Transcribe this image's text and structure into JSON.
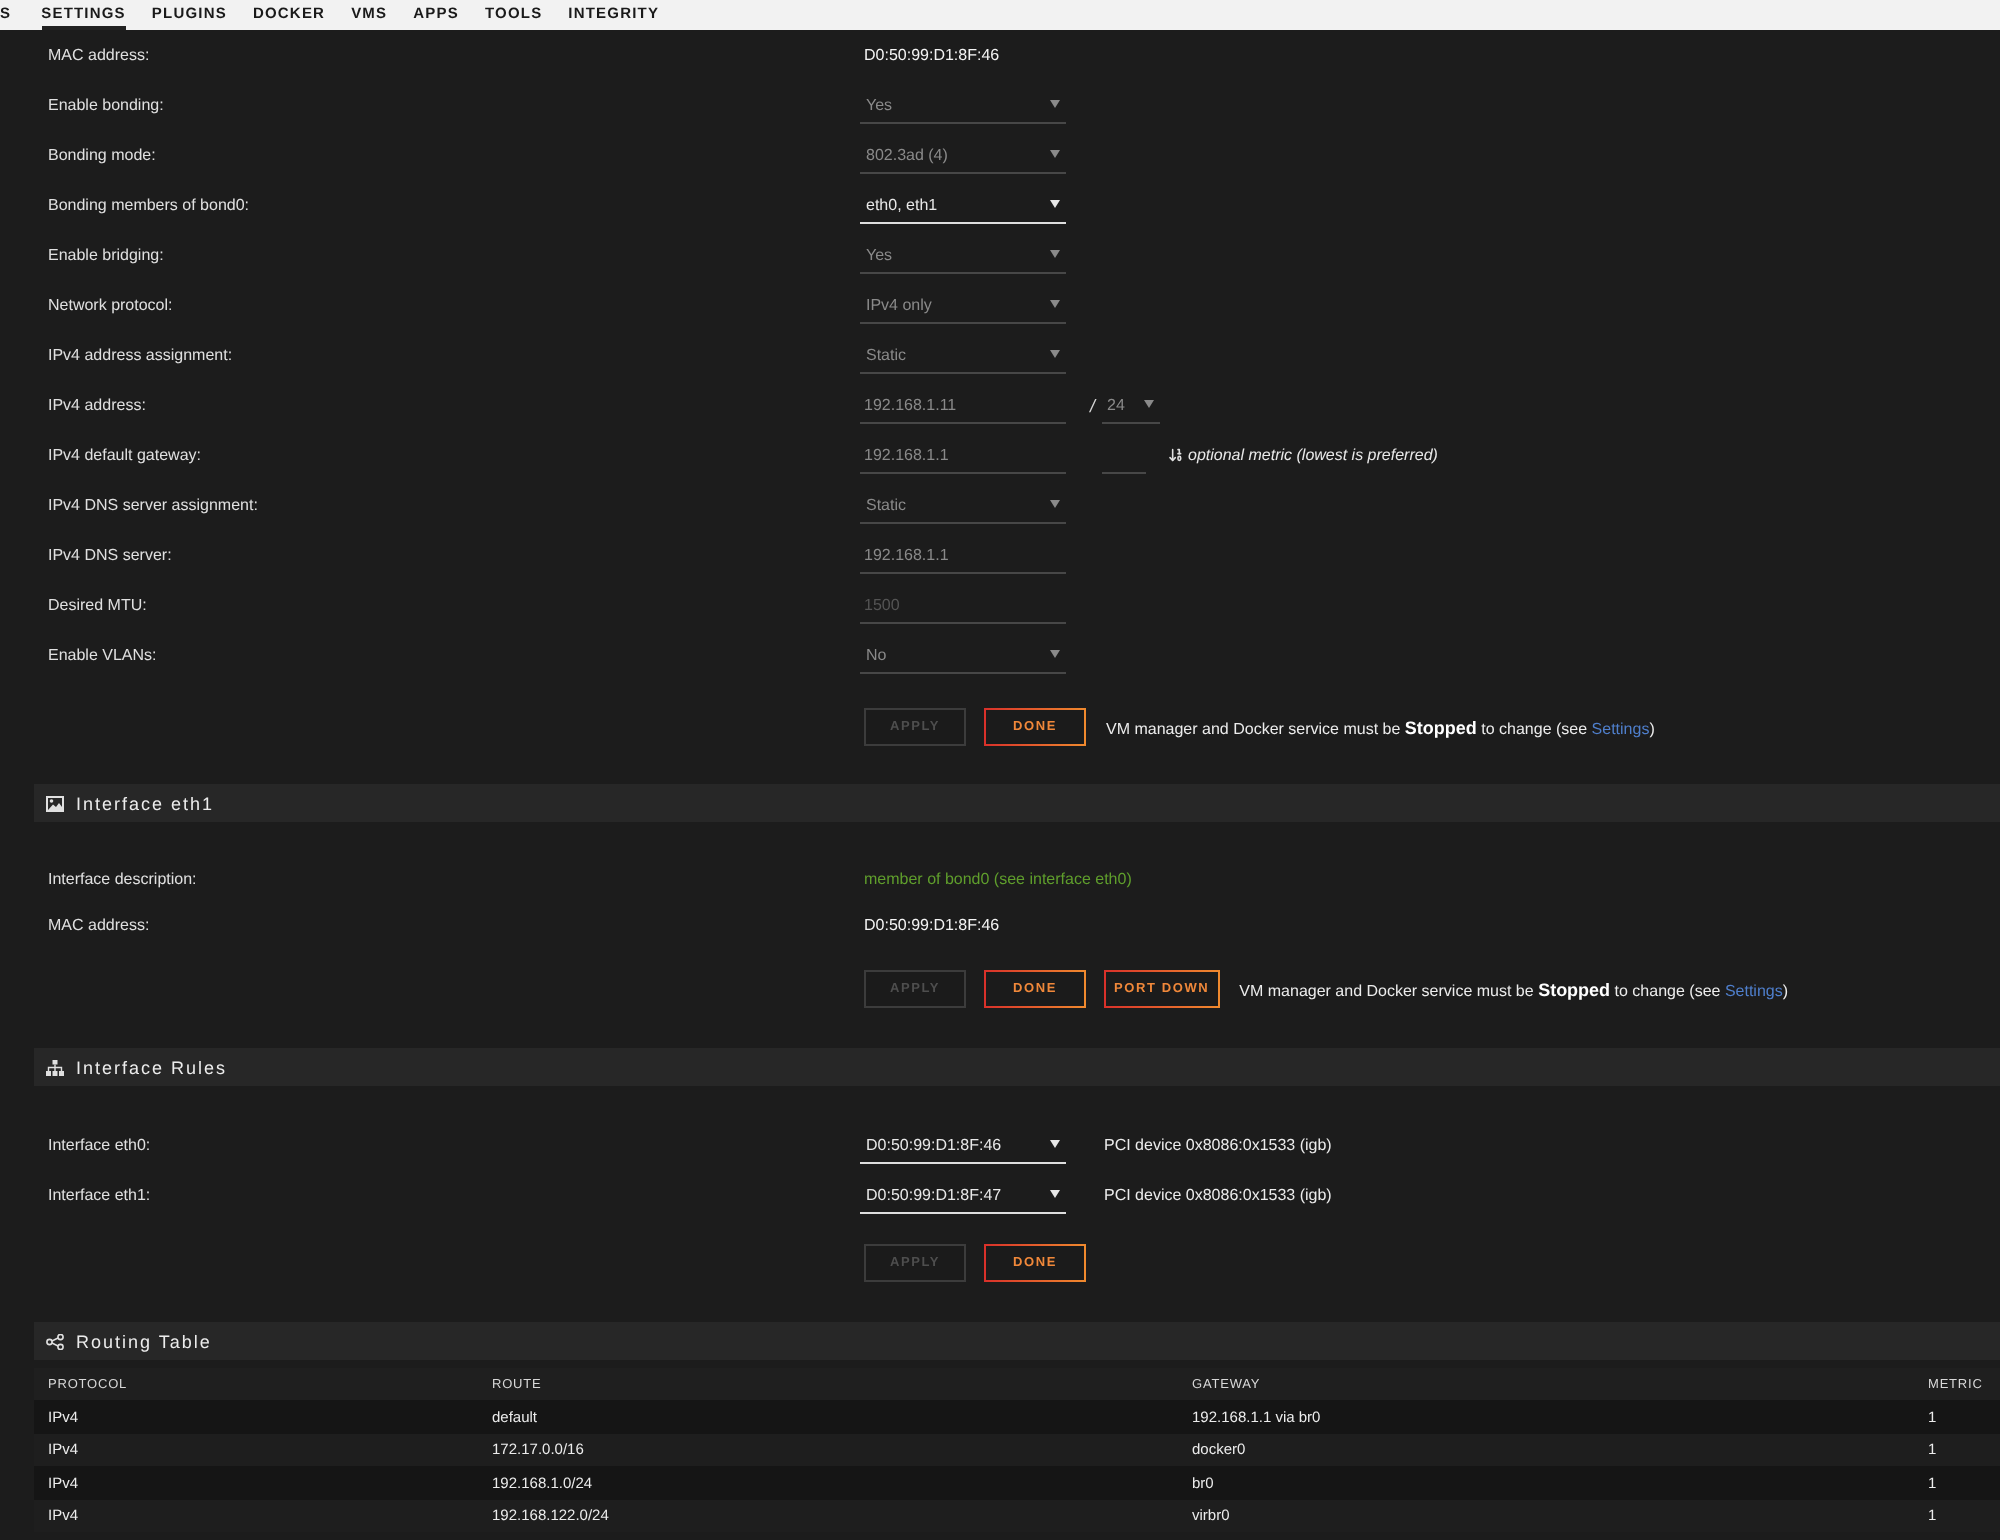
{
  "top_nav": {
    "tabs": [
      {
        "label": "S",
        "selected": false
      },
      {
        "label": "SETTINGS",
        "selected": true
      },
      {
        "label": "PLUGINS",
        "selected": false
      },
      {
        "label": "DOCKER",
        "selected": false
      },
      {
        "label": "VMS",
        "selected": false
      },
      {
        "label": "APPS",
        "selected": false
      },
      {
        "label": "TOOLS",
        "selected": false
      },
      {
        "label": "INTEGRITY",
        "selected": false
      }
    ]
  },
  "interface_eth0": {
    "rows": [
      {
        "label": "MAC address:",
        "kind": "text",
        "value": "D0:50:99:D1:8F:46"
      },
      {
        "label": "Enable bonding:",
        "kind": "select",
        "value": "Yes",
        "disabled": true
      },
      {
        "label": "Bonding mode:",
        "kind": "select",
        "value": "802.3ad (4)",
        "disabled": true
      },
      {
        "label": "Bonding members of bond0:",
        "kind": "select",
        "value": "eth0, eth1",
        "disabled": false
      },
      {
        "label": "Enable bridging:",
        "kind": "select",
        "value": "Yes",
        "disabled": true
      },
      {
        "label": "Network protocol:",
        "kind": "select",
        "value": "IPv4 only",
        "disabled": true
      },
      {
        "label": "IPv4 address assignment:",
        "kind": "select",
        "value": "Static",
        "disabled": true
      },
      {
        "label": "IPv4 address:",
        "kind": "address",
        "value": "192.168.1.11",
        "disabled": true,
        "separator": "/",
        "prefix": "24"
      },
      {
        "label": "IPv4 default gateway:",
        "kind": "gateway",
        "value": "192.168.1.1",
        "disabled": true,
        "metric_hint": "optional metric (lowest is preferred)"
      },
      {
        "label": "IPv4 DNS server assignment:",
        "kind": "select",
        "value": "Static",
        "disabled": true
      },
      {
        "label": "IPv4 DNS server:",
        "kind": "input",
        "value": "192.168.1.1",
        "disabled": true
      },
      {
        "label": "Desired MTU:",
        "kind": "input",
        "placeholder": "1500",
        "disabled": true
      },
      {
        "label": "Enable VLANs:",
        "kind": "select",
        "value": "No",
        "disabled": true
      }
    ],
    "buttons": [
      {
        "label": "APPLY",
        "disabled": true
      },
      {
        "label": "DONE",
        "disabled": false
      }
    ],
    "notice": {
      "text": "VM manager and Docker service must be **Stopped** to change (see ",
      "link": "Settings",
      "after": ")"
    }
  },
  "interface_eth1": {
    "title": "Interface eth1",
    "rows": [
      {
        "label": "Interface description:",
        "kind": "status",
        "value": "member of bond0 (see interface eth0)"
      },
      {
        "label": "MAC address:",
        "kind": "text",
        "value": "D0:50:99:D1:8F:46"
      }
    ],
    "buttons": [
      {
        "label": "APPLY",
        "disabled": true
      },
      {
        "label": "DONE",
        "disabled": false
      },
      {
        "label": "PORT DOWN",
        "disabled": false
      }
    ],
    "notice": {
      "text": "VM manager and Docker service must be **Stopped** to change (see ",
      "link": "Settings",
      "after": ")"
    }
  },
  "interface_rules": {
    "title": "Interface Rules",
    "rows": [
      {
        "label": "Interface eth0:",
        "value": "D0:50:99:D1:8F:46",
        "disabled": false,
        "device": "PCI device 0x8086:0x1533 (igb)"
      },
      {
        "label": "Interface eth1:",
        "value": "D0:50:99:D1:8F:47",
        "disabled": false,
        "device": "PCI device 0x8086:0x1533 (igb)"
      }
    ],
    "buttons": [
      {
        "label": "APPLY",
        "disabled": true
      },
      {
        "label": "DONE",
        "disabled": false
      }
    ]
  },
  "routing_table": {
    "title": "Routing Table",
    "columns": [
      "PROTOCOL",
      "ROUTE",
      "GATEWAY",
      "METRIC"
    ],
    "rows": [
      [
        "IPv4",
        "default",
        "192.168.1.1 via br0",
        "1"
      ],
      [
        "IPv4",
        "172.17.0.0/16",
        "docker0",
        "1"
      ],
      [
        "IPv4",
        "192.168.1.0/24",
        "br0",
        "1"
      ],
      [
        "IPv4",
        "192.168.122.0/24",
        "virbr0",
        "1"
      ]
    ]
  }
}
